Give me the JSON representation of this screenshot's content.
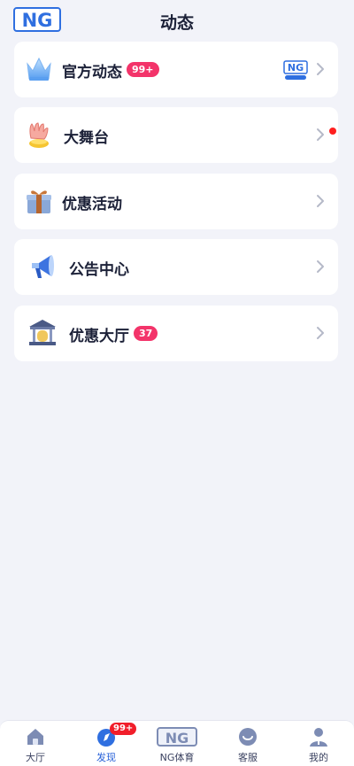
{
  "header": {
    "logo_text": "NG",
    "title": "动态"
  },
  "menu": [
    {
      "label": "官方动态",
      "badge": "99+",
      "icon": "crown-icon",
      "extra": "ng-logo"
    },
    {
      "label": "大舞台",
      "icon": "stage-hand-icon",
      "red_dot": true
    },
    {
      "label": "优惠活动",
      "icon": "gift-box-icon"
    },
    {
      "label": "公告中心",
      "icon": "megaphone-icon"
    },
    {
      "label": "优惠大厅",
      "badge": "37",
      "icon": "hall-building-icon"
    }
  ],
  "tabbar": {
    "items": [
      {
        "label": "大厅",
        "icon": "home-icon"
      },
      {
        "label": "发现",
        "icon": "compass-icon",
        "badge": "99+",
        "active": true
      },
      {
        "label": "NG体育",
        "icon": "ng-logo-icon",
        "logo_text": "NG"
      },
      {
        "label": "客服",
        "icon": "support-icon"
      },
      {
        "label": "我的",
        "icon": "user-icon"
      }
    ]
  },
  "colors": {
    "background": "#f2f3f9",
    "card": "#ffffff",
    "badge": "#f3346a",
    "active_tab": "#2760d8",
    "text": "#1c2138"
  }
}
